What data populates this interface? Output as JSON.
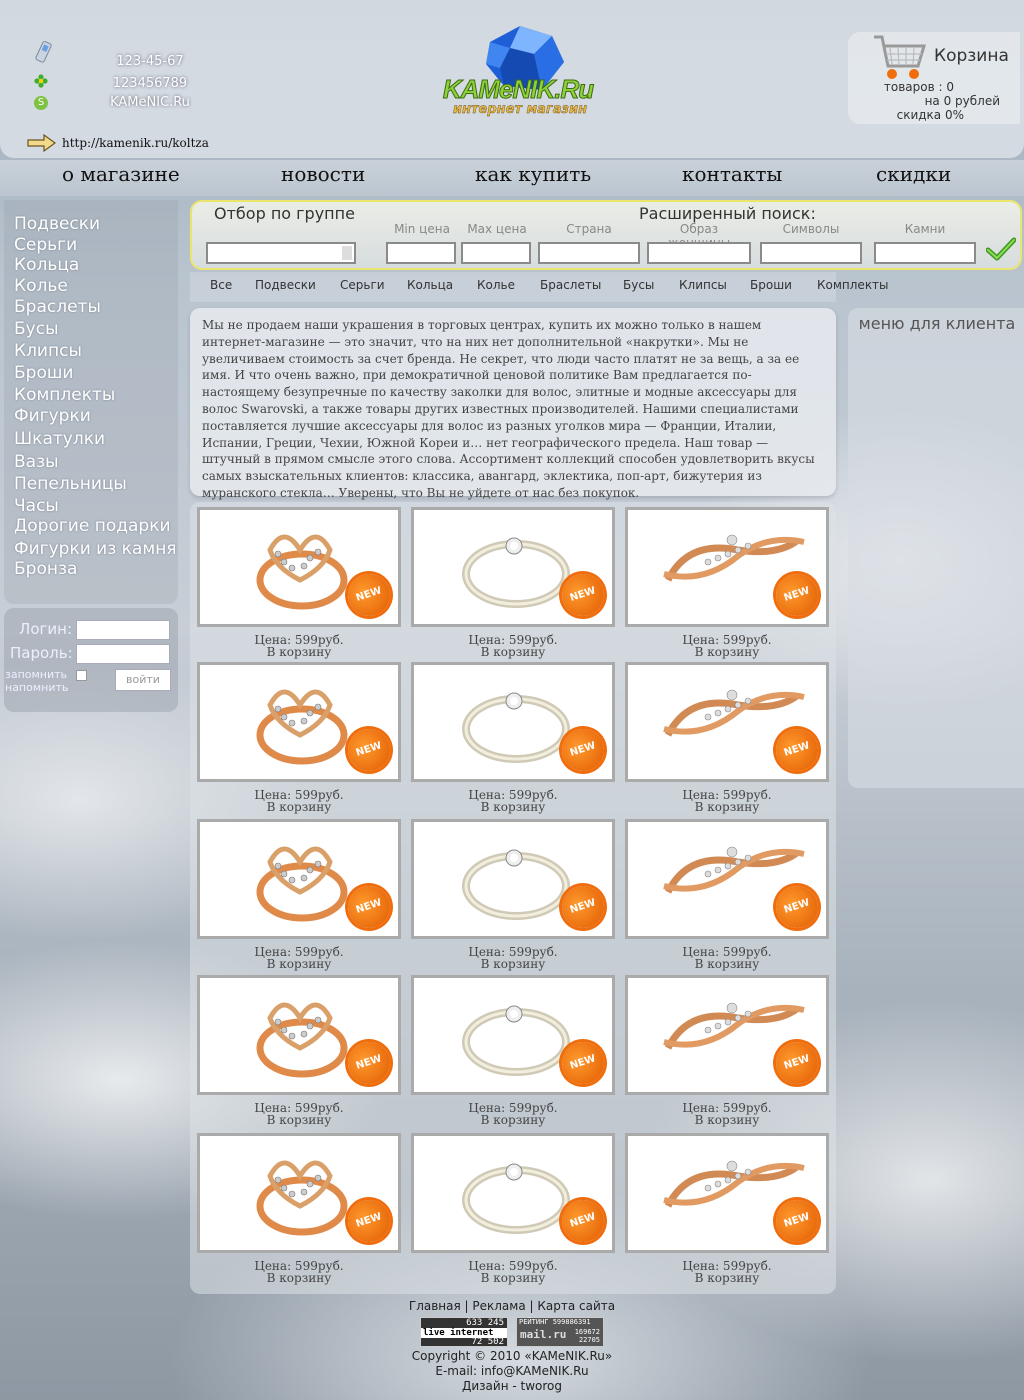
{
  "header": {
    "contacts": [
      {
        "icon": "phone-icon",
        "text": "123-45-67"
      },
      {
        "icon": "icq-icon",
        "text": "123456789"
      },
      {
        "icon": "skype-icon",
        "text": "KAMeNIC.Ru"
      }
    ],
    "url": "http://kamenik.ru/koltza",
    "logo_text": "KAMeNIK.Ru",
    "logo_sub": "интернет магазин",
    "cart": {
      "title": "Корзина",
      "items": "товаров : 0",
      "sum": "на 0 рублей",
      "discount": "скидка 0%"
    }
  },
  "nav": [
    "о магазине",
    "новости",
    "как купить",
    "контакты",
    "скидки"
  ],
  "sidebar": {
    "items": [
      "Подвески",
      "Серьги",
      "Кольца",
      "Колье",
      "Браслеты",
      "Бусы",
      "Клипсы",
      "Броши",
      "Комплекты",
      "Фигурки",
      "Шкатулки",
      "Вазы",
      "Пепельницы",
      "Часы",
      "Дорогие подарки",
      "Фигурки из камня",
      "Бронза"
    ]
  },
  "login": {
    "login_label": "Логин:",
    "password_label": "Пароль:",
    "remember": "запомнить",
    "remember2": "напомнить",
    "button": "войти"
  },
  "search": {
    "group_title": "Отбор по группе",
    "advanced_title": "Расширенный поиск:",
    "fields": [
      "Min цена",
      "Max цена",
      "Страна",
      "Образ женщины",
      "Символы",
      "Камни"
    ]
  },
  "tabs": [
    "Все",
    "Подвески",
    "Серьги",
    "Кольца",
    "Колье",
    "Браслеты",
    "Бусы",
    "Клипсы",
    "Броши",
    "Комплекты"
  ],
  "intro": "Мы не продаем наши украшения в торговых центрах, купить их можно только в нашем интернет-магазине — это значит, что на них нет дополнительной «накрутки». Мы не увеличиваем стоимость за счет бренда. Не секрет, что люди часто платят не за вещь, а за ее имя. И что очень важно, при демократичной ценовой политике Вам предлагается по-настоящему безупречные по качеству заколки для волос, элитные и модные аксессуары для волос Swarovski, а также товары других известных производителей. Нашими специалистами поставляется лучшие аксессуары для волос из разных уголков мира — Франции, Италии, Испании, Греции, Чехии, Южной Кореи и… нет географического предела. Наш товар — штучный в прямом смысле этого слова. Ассортимент коллекций способен удовлетворить вкусы самых взыскательных клиентов: классика, авангард, эклектика, поп-арт, бижутерия из муранского стекла… Уверены, что Вы не уйдете от нас без покупок.",
  "right": {
    "title": "меню для клиента"
  },
  "product": {
    "price": "Цена: 599руб.",
    "cart": "В корзину",
    "badge": "NEW"
  },
  "footer": {
    "links": "Главная | Реклама | Карта сайта",
    "copyright": "Copyright © 2010 «KAMeNIK.Ru»",
    "email": "E-mail: info@KAMeNIK.Ru",
    "design": "Дизайн - tworog",
    "counter1": {
      "top": "633 245",
      "mid": "live internet",
      "bottom": "72 502"
    },
    "counter2": {
      "top": "РЕЙТИНГ 599886391",
      "mid": "mail.ru",
      "n1": "169672",
      "n2": "22705"
    }
  },
  "colors": {
    "logo_green": "#8ed23a",
    "badge_orange": "#f06d0e",
    "search_border": "#e9e56d"
  }
}
